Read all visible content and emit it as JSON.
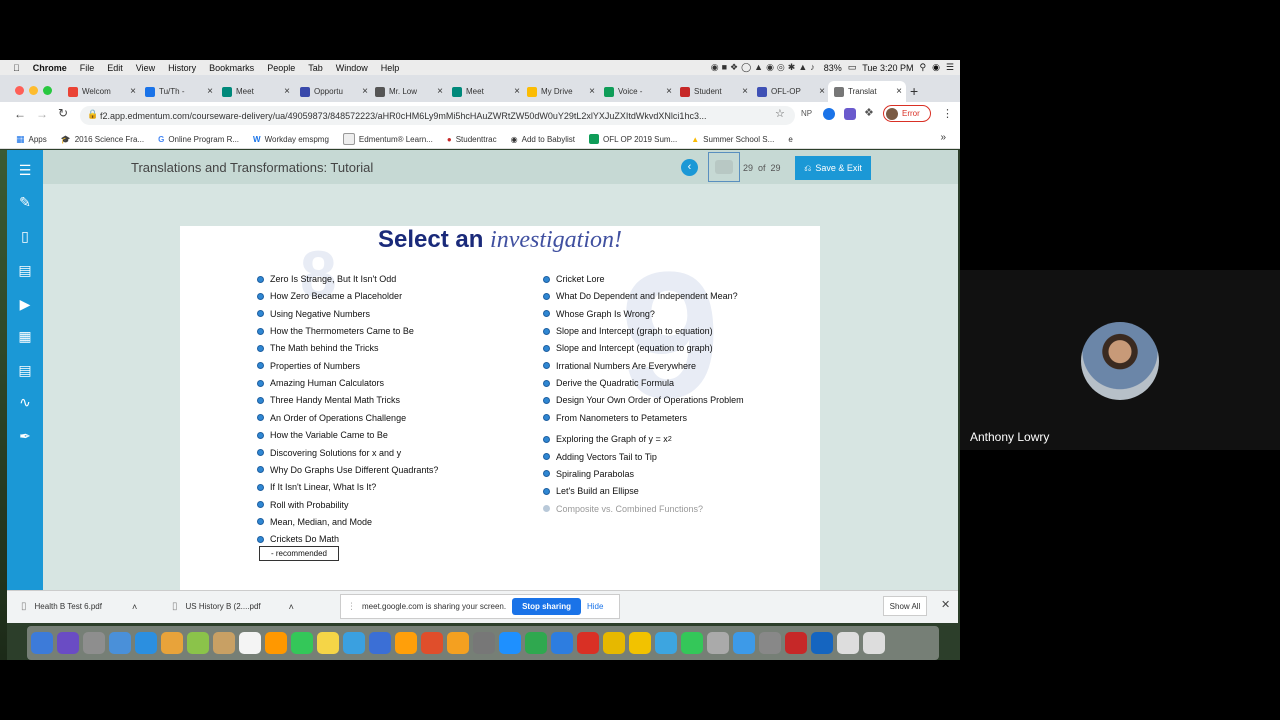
{
  "menubar": {
    "apple": "",
    "app": "Chrome",
    "items": [
      "File",
      "Edit",
      "View",
      "History",
      "Bookmarks",
      "People",
      "Tab",
      "Window",
      "Help"
    ],
    "battery": "83%",
    "clock": "Tue 3:20 PM"
  },
  "tabs": [
    {
      "label": "Welcom",
      "color": "#ea4335",
      "icon": "gmail-icon"
    },
    {
      "label": "Tu/Th -",
      "color": "#1a73e8",
      "icon": "classroom-icon"
    },
    {
      "label": "Meet",
      "color": "#00897b",
      "icon": "meet-icon"
    },
    {
      "label": "Opportu",
      "color": "#3949ab",
      "icon": "doc-icon"
    },
    {
      "label": "Mr. Low",
      "color": "#555555",
      "icon": "page-icon"
    },
    {
      "label": "Meet",
      "color": "#00897b",
      "icon": "meet-icon"
    },
    {
      "label": "My Drive",
      "color": "#fbbc04",
      "icon": "drive-icon"
    },
    {
      "label": "Voice -",
      "color": "#0f9d58",
      "icon": "voice-icon"
    },
    {
      "label": "Student",
      "color": "#c62828",
      "icon": "apple-icon"
    },
    {
      "label": "OFL-OP",
      "color": "#3f51b5",
      "icon": "calendar-icon"
    },
    {
      "label": "Translat",
      "color": "#777777",
      "icon": "edmentum-icon"
    }
  ],
  "toolbar": {
    "url": "f2.app.edmentum.com/courseware-delivery/ua/49059873/848572223/aHR0cHM6Ly9mMi5hcHAuZWRtZW50dW0uY29tL2xlYXJuZXItdWkvdXNlci1hc3...",
    "profile_status": "Error",
    "ext_np": "NP"
  },
  "bookmarks": [
    "Apps",
    "2016 Science Fra...",
    "Online Program R...",
    "Workday emspmg",
    "Edmentum® Learn...",
    "Studenttrac",
    "Add to Babylist",
    "OFL OP 2019 Sum...",
    "Summer School S..."
  ],
  "app": {
    "title": "Translations and Transformations: Tutorial",
    "page_current": "29",
    "page_of": "of",
    "page_total": "29",
    "save_exit": "Save & Exit"
  },
  "investigation": {
    "heading_plain": "Select an",
    "heading_italic": "investigation!",
    "left": [
      "Zero Is Strange, But It Isn't Odd",
      "How Zero Became a Placeholder",
      "Using Negative Numbers",
      "How the Thermometers Came to Be",
      "The Math behind the Tricks",
      "Properties of Numbers",
      "Amazing Human Calculators",
      "Three Handy Mental Math Tricks",
      "An Order of Operations Challenge",
      "How the Variable Came to Be",
      "Discovering Solutions for x and y",
      "Why Do Graphs Use Different Quadrants?",
      "If It Isn't Linear, What Is It?",
      "Roll with Probability",
      "Mean, Median, and Mode",
      "Crickets Do Math"
    ],
    "right": [
      "Cricket Lore",
      "What Do Dependent and Independent Mean?",
      "Whose Graph Is Wrong?",
      "Slope and Intercept (graph to equation)",
      "Slope and Intercept (equation to graph)",
      "Irrational Numbers Are Everywhere",
      "Derive the Quadratic Formula",
      "Design Your Own Order of Operations Problem",
      "From Nanometers to Petameters",
      "Exploring the Graph of y = x",
      "Adding Vectors Tail to Tip",
      "Spiraling Parabolas",
      "Let's Build an Ellipse",
      "Composite vs. Combined Functions?"
    ],
    "exponent": "2",
    "legend": "- recommended"
  },
  "downloads": {
    "file1": "Health B Test 6.pdf",
    "file2": "US History B (2....pdf",
    "sharing_text": "meet.google.com is sharing your screen.",
    "stop_sharing": "Stop sharing",
    "hide": "Hide",
    "show_all": "Show All"
  },
  "participant": {
    "name": "Anthony Lowry"
  }
}
